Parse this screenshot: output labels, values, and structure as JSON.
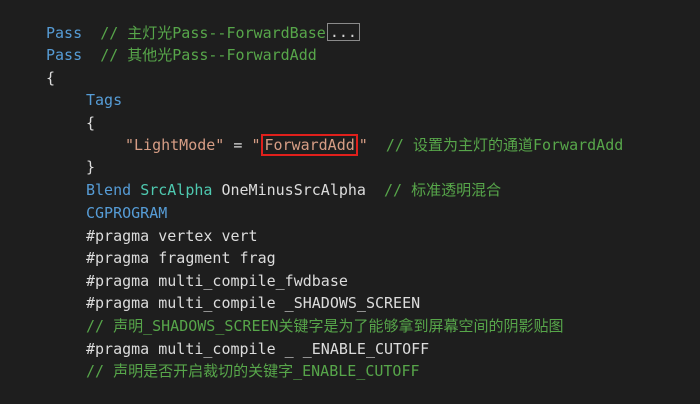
{
  "code": {
    "line1": {
      "kw": "Pass",
      "comment": "// 主灯光Pass--ForwardBase",
      "fold": "..."
    },
    "line2": {
      "kw": "Pass",
      "comment": "// 其他光Pass--ForwardAdd"
    },
    "line3": {
      "text": "{"
    },
    "line4": {
      "kw": "Tags"
    },
    "line5": {
      "text": "{"
    },
    "line6": {
      "key": "\"LightMode\"",
      "eq": " = ",
      "q_open": "\"",
      "value": "ForwardAdd",
      "q_close": "\"",
      "comment": "// 设置为主灯的通道ForwardAdd"
    },
    "line7": {
      "text": "}"
    },
    "line8": {
      "kw": "Blend",
      "src": "SrcAlpha",
      "dst": "OneMinusSrcAlpha",
      "comment": "// 标准透明混合"
    },
    "line9": {
      "kw": "CGPROGRAM"
    },
    "line10": {
      "text": "#pragma vertex vert"
    },
    "line11": {
      "text": "#pragma fragment frag"
    },
    "line12": {
      "text": "#pragma multi_compile_fwdbase"
    },
    "line13": {
      "text": "#pragma multi_compile _SHADOWS_SCREEN"
    },
    "line14": {
      "comment": "// 声明_SHADOWS_SCREEN关键字是为了能够拿到屏幕空间的阴影贴图"
    },
    "line15": {
      "text": "#pragma multi_compile _ _ENABLE_CUTOFF"
    },
    "line16": {
      "comment": "// 声明是否开启裁切的关键字_ENABLE_CUTOFF"
    }
  },
  "colors": {
    "background": "#1e1e1e",
    "keyword": "#569cd6",
    "comment": "#57a64a",
    "string": "#d69d85",
    "plain": "#dcdcdc",
    "highlight_border": "#e0201c"
  }
}
